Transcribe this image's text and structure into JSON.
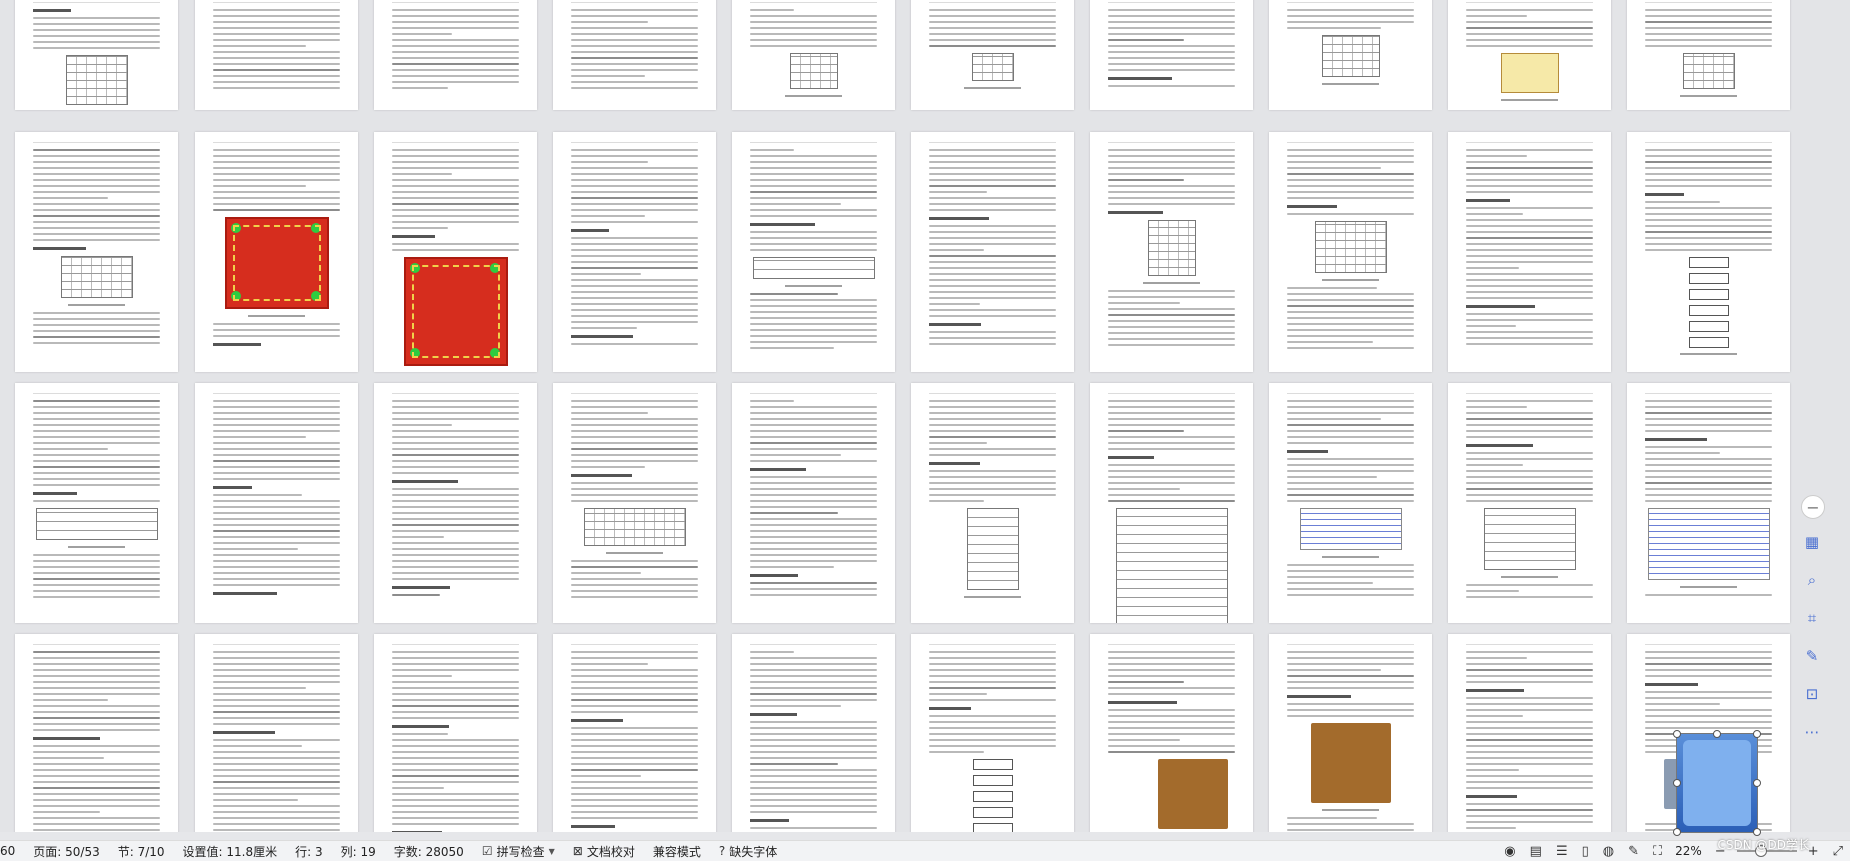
{
  "status_bar": {
    "page_count_partial": "60",
    "page": "页面: 50/53",
    "section": "节: 7/10",
    "setting": "设置值: 11.8厘米",
    "row": "行: 3",
    "col": "列: 19",
    "words": "字数: 28050",
    "spell_check": "拼写检查",
    "doc_proof": "文档校对",
    "compat_mode": "兼容模式",
    "missing_font": "缺失字体",
    "zoom": "22%",
    "icons": {
      "eye": "eye-icon",
      "page_view": "page-view-icon",
      "outline_view": "outline-view-icon",
      "read_view": "read-mode-icon",
      "web_view": "web-view-icon",
      "write_view": "pen-icon",
      "fit": "fit-page-icon",
      "zoom_out": "zoom-out-icon",
      "zoom_in": "zoom-in-icon"
    }
  },
  "right_tools": [
    "minus-icon",
    "table-icon",
    "zoom-icon",
    "crop-icon",
    "edit-image-icon",
    "ocr-icon",
    "more-icon"
  ],
  "watermark": "CSDN @DD学长"
}
